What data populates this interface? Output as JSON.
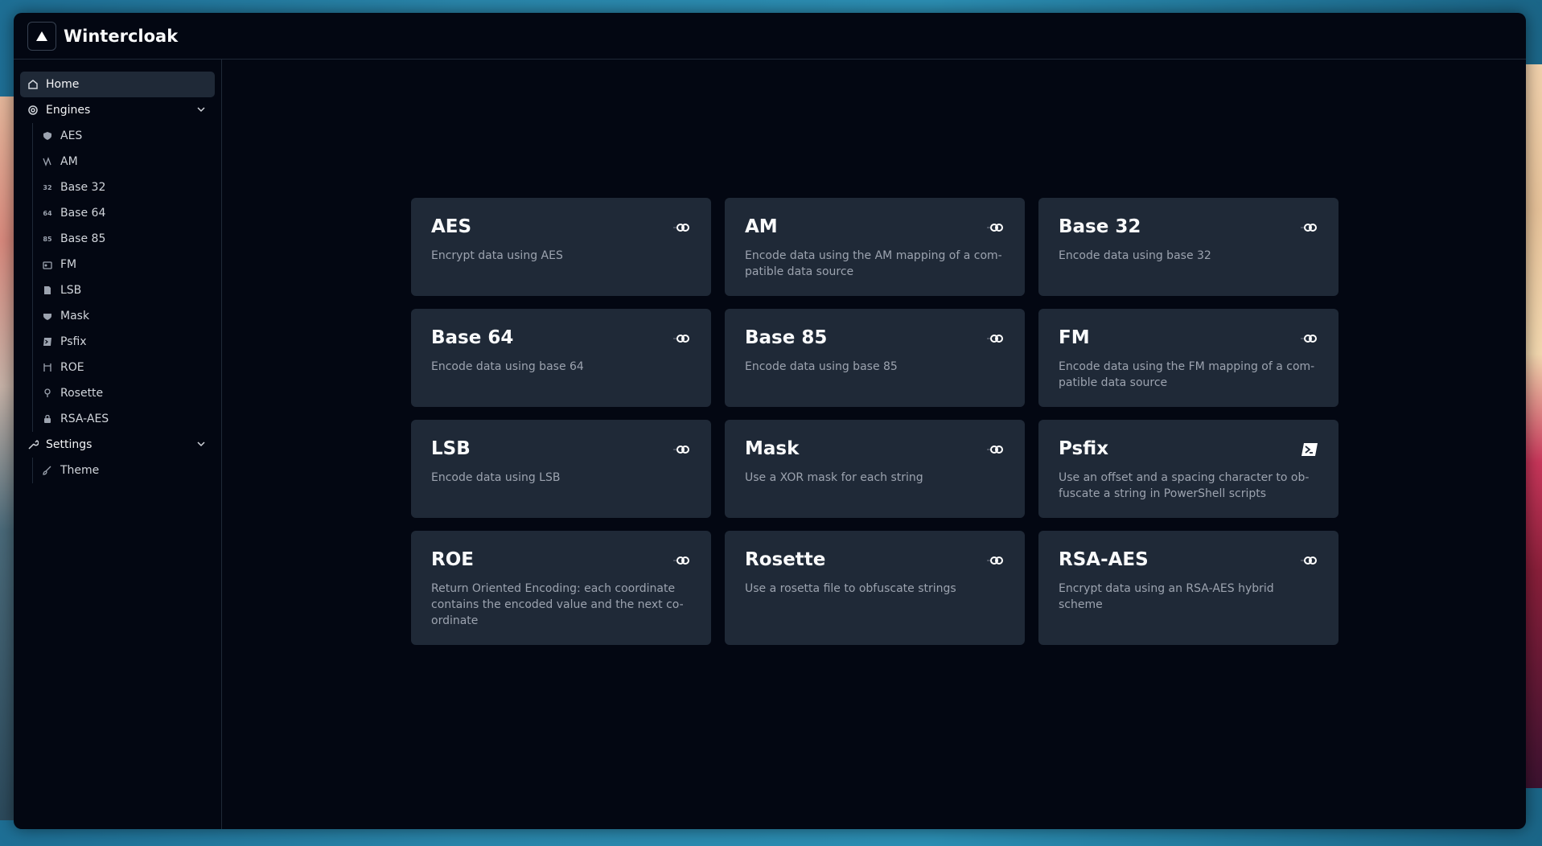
{
  "app": {
    "title": "Wintercloak"
  },
  "sidebar": {
    "home": "Home",
    "engines": {
      "label": "Engines",
      "items": [
        {
          "label": "AES",
          "icon": "shield-icon"
        },
        {
          "label": "AM",
          "icon": "wave-icon"
        },
        {
          "label": "Base 32",
          "icon": "32-icon",
          "glyph": "32"
        },
        {
          "label": "Base 64",
          "icon": "64-icon",
          "glyph": "64"
        },
        {
          "label": "Base 85",
          "icon": "85-icon",
          "glyph": "85"
        },
        {
          "label": "FM",
          "icon": "radio-icon"
        },
        {
          "label": "LSB",
          "icon": "file-icon"
        },
        {
          "label": "Mask",
          "icon": "mask-icon"
        },
        {
          "label": "Psfix",
          "icon": "terminal-icon"
        },
        {
          "label": "ROE",
          "icon": "route-icon"
        },
        {
          "label": "Rosette",
          "icon": "pin-icon"
        },
        {
          "label": "RSA-AES",
          "icon": "lock-icon"
        }
      ]
    },
    "settings": {
      "label": "Settings",
      "items": [
        {
          "label": "Theme",
          "icon": "brush-icon"
        }
      ]
    }
  },
  "cards": [
    {
      "title": "AES",
      "desc": "Encrypt data using AES",
      "icon": "link-icon"
    },
    {
      "title": "AM",
      "desc": "Encode data using the AM mapping of a com-patible data source",
      "icon": "link-icon"
    },
    {
      "title": "Base 32",
      "desc": "Encode data using base 32",
      "icon": "link-icon"
    },
    {
      "title": "Base 64",
      "desc": "Encode data using base 64",
      "icon": "link-icon"
    },
    {
      "title": "Base 85",
      "desc": "Encode data using base 85",
      "icon": "link-icon"
    },
    {
      "title": "FM",
      "desc": "Encode data using the FM mapping of a com-patible data source",
      "icon": "link-icon"
    },
    {
      "title": "LSB",
      "desc": "Encode data using LSB",
      "icon": "link-icon"
    },
    {
      "title": "Mask",
      "desc": "Use a XOR mask for each string",
      "icon": "link-icon"
    },
    {
      "title": "Psfix",
      "desc": "Use an offset and a spacing character to ob-fuscate a string in PowerShell scripts",
      "icon": "terminal-icon"
    },
    {
      "title": "ROE",
      "desc": "Return Oriented Encoding: each coordinate contains the encoded value and the next co-ordinate",
      "icon": "link-icon"
    },
    {
      "title": "Rosette",
      "desc": "Use a rosetta file to obfuscate strings",
      "icon": "link-icon"
    },
    {
      "title": "RSA-AES",
      "desc": "Encrypt data using an RSA-AES hybrid scheme",
      "icon": "link-icon"
    }
  ]
}
